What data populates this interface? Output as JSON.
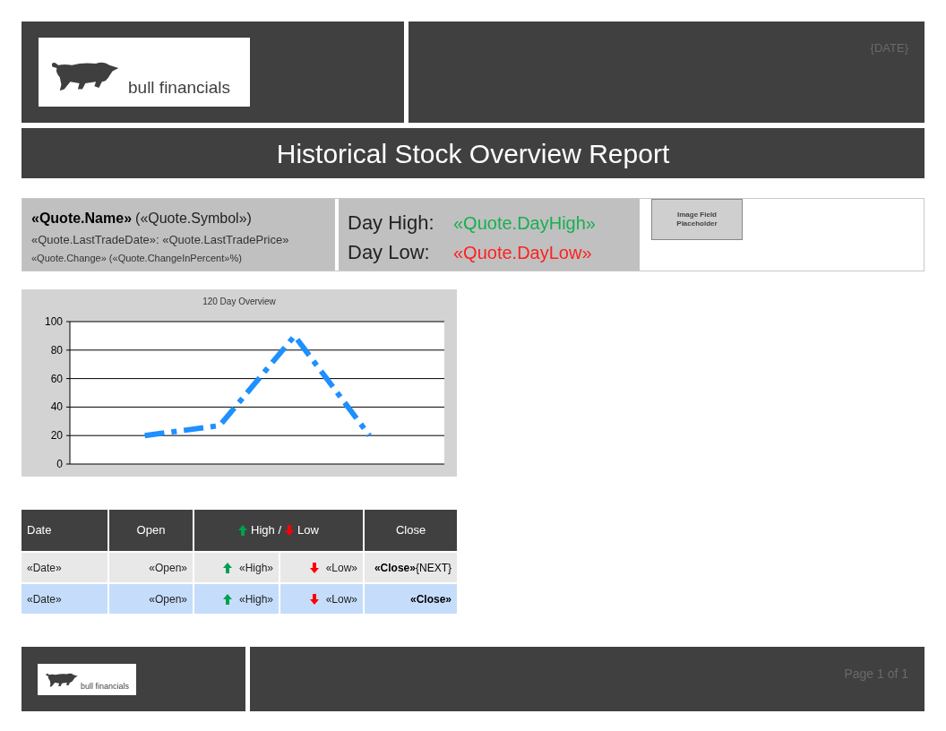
{
  "header": {
    "logo_text": "bull financials",
    "date": "{DATE}"
  },
  "title": "Historical Stock Overview Report",
  "quote": {
    "name": "«Quote.Name»",
    "symbol": "(«Quote.Symbol»)",
    "trade": "«Quote.LastTradeDate»: «Quote.LastTradePrice»",
    "change": "«Quote.Change» («Quote.ChangeInPercent»%)",
    "day_high_label": "Day High:",
    "day_high": "«Quote.DayHigh»",
    "day_low_label": "Day Low:",
    "day_low": "«Quote.DayLow»",
    "image_placeholder": "Image Field Placeholder"
  },
  "chart": {
    "chart_data": {
      "type": "line",
      "title": "120 Day Overview",
      "grid": true,
      "categories": [
        null,
        null,
        null,
        null,
        null,
        null
      ],
      "ylim": [
        0,
        100
      ],
      "yticks": [
        0,
        20,
        40,
        60,
        80,
        100
      ],
      "series": [
        {
          "color": "#1e90ff",
          "line_style": "dashdot",
          "values": [
            null,
            20,
            27,
            90,
            20,
            null
          ]
        }
      ]
    }
  },
  "table": {
    "columns": [
      {
        "label": "Date",
        "kind": "plain"
      },
      {
        "label": "Open",
        "kind": "plain"
      },
      {
        "label": "High /",
        "label_2": "Low",
        "kind": "highlow"
      },
      {
        "label": "Close",
        "kind": "plain"
      }
    ],
    "rows": [
      {
        "selected": false,
        "date": "«Date»",
        "open": "«Open»",
        "high": "«High»",
        "low": "«Low»",
        "close": "«Close»",
        "close_suffix": "{NEXT}"
      },
      {
        "selected": true,
        "date": "«Date»",
        "open": "«Open»",
        "high": "«High»",
        "low": "«Low»",
        "close": "«Close»"
      }
    ]
  },
  "footer": {
    "logo_text": "bull financials",
    "page": "Page 1 of 1"
  }
}
